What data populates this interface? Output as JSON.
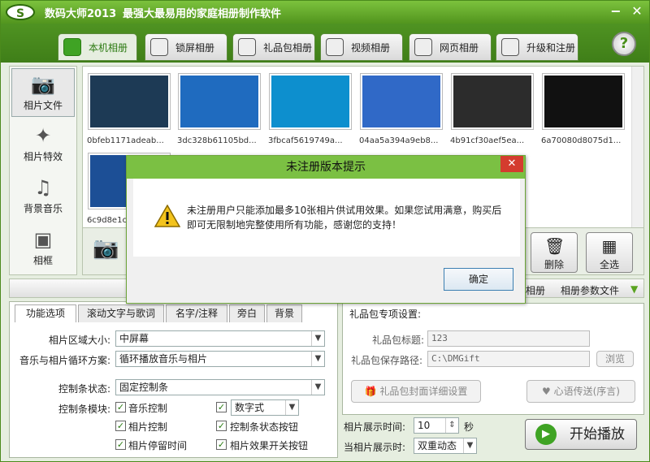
{
  "window": {
    "app_name": "数码大师2013",
    "slogan": "最强大最易用的家庭相册制作软件",
    "logo_text": "S"
  },
  "tabs": [
    {
      "label": "本机相册",
      "icon": "photo-album-icon"
    },
    {
      "label": "锁屏相册",
      "icon": "monitor-icon"
    },
    {
      "label": "礼品包相册",
      "icon": "gift-icon"
    },
    {
      "label": "视频相册",
      "icon": "film-icon"
    },
    {
      "label": "网页相册",
      "icon": "ie-browser-icon"
    },
    {
      "label": "升级和注册",
      "icon": "globe-icon"
    }
  ],
  "help": {
    "label": "?"
  },
  "sidebar": {
    "items": [
      {
        "label": "相片文件",
        "icon": "camera-icon"
      },
      {
        "label": "相片特效",
        "icon": "sparkle-icon"
      },
      {
        "label": "背景音乐",
        "icon": "music-note-icon"
      },
      {
        "label": "相框",
        "icon": "frame-icon"
      }
    ]
  },
  "gallery": {
    "thumbs": [
      {
        "label": "0bfeb1171adeab...",
        "color": "#1d3a55"
      },
      {
        "label": "3dc328b61105bd...",
        "color": "#1f6bbf"
      },
      {
        "label": "3fbcaf5619749a...",
        "color": "#0d8fce"
      },
      {
        "label": "04aa5a394a9eb8...",
        "color": "#3069c7"
      },
      {
        "label": "4b91cf30aef5ea...",
        "color": "#2c2c2c"
      },
      {
        "label": "6a70080d8075d1...",
        "color": "#111111"
      },
      {
        "label": "6c9d8e1c",
        "color": "#1c4f96"
      }
    ]
  },
  "actions": {
    "delete_label": "删除",
    "select_all_label": "全选"
  },
  "toolbar2": {
    "album_label": "相册",
    "params_label": "相册参数文件"
  },
  "options_tabs": [
    "功能选项",
    "滚动文字与歌词",
    "名字/注释",
    "旁白",
    "背景"
  ],
  "options": {
    "area_size_label": "相片区域大小:",
    "area_size_value": "中屏幕",
    "loop_label": "音乐与相片循环方案:",
    "loop_value": "循环播放音乐与相片",
    "control_bar_label": "控制条状态:",
    "control_bar_value": "固定控制条",
    "control_module_label": "控制条模块:",
    "checks": [
      {
        "label": "音乐控制",
        "checked": true
      },
      {
        "label": "数字式",
        "checked": true
      },
      {
        "label": "相片控制",
        "checked": true
      },
      {
        "label": "控制条状态按钮",
        "checked": true
      },
      {
        "label": "相片停留时间",
        "checked": true
      },
      {
        "label": "相片效果开关按钮",
        "checked": true
      }
    ]
  },
  "gift": {
    "title": "礼品包专项设置:",
    "title_label": "礼品包标题:",
    "title_value": "123",
    "path_label": "礼品包保存路径:",
    "path_value": "C:\\DMGift",
    "browse_label": "浏览",
    "cover_label": "礼品包封面详细设置",
    "message_label": "心语传送(序言)"
  },
  "playback": {
    "time_label": "相片展示时间:",
    "time_value": "10",
    "time_unit": "秒",
    "mode_label": "当相片展示时:",
    "mode_value": "双重动态",
    "play_label": "开始播放"
  },
  "dialog": {
    "title": "未注册版本提示",
    "message": "未注册用户只能添加最多10张相片供试用效果。如果您试用满意，购买后即可无限制地完整使用所有功能，感谢您的支持！",
    "ok_label": "确定",
    "close_label": "✕"
  },
  "colors": {
    "accent": "#52951e",
    "dialog_title": "#7bc043",
    "close_red": "#d43c2e"
  }
}
